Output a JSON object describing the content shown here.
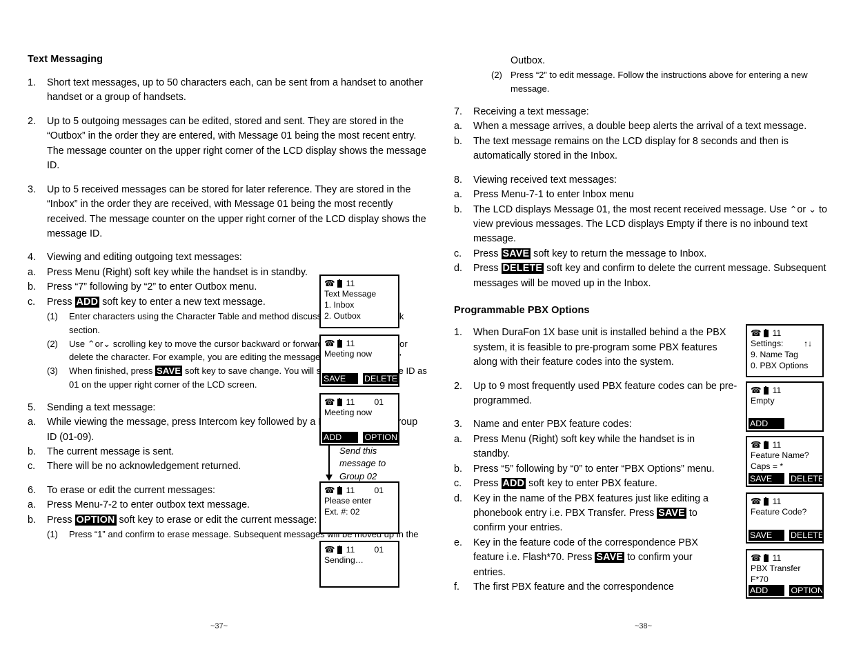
{
  "left_column": {
    "heading": "Text Messaging",
    "items": [
      {
        "num": "1.",
        "text": "Short text messages, up to 50 characters each, can be sent from a handset to another handset or a group of handsets."
      },
      {
        "num": "2.",
        "text": "Up to 5 outgoing messages can be edited, stored and sent.  They are stored in the “Outbox” in the order they are entered, with Message 01 being the most recent entry.  The message counter on the upper right corner of the LCD display shows the message ID."
      },
      {
        "num": "3.",
        "text": "Up to 5 received messages can be stored for later reference.  They are stored in the “Inbox” in the order they are received, with Message 01 being the most recently received.  The message counter on the upper right corner of the LCD display shows the message ID."
      },
      {
        "num": "4.",
        "text": "Viewing and editing outgoing text messages:"
      },
      {
        "num": "5.",
        "text": "Sending a text message:"
      },
      {
        "num": "6.",
        "text": "To erase or edit the current messages:"
      }
    ],
    "item4_sub": [
      {
        "num": "a.",
        "text": "Press Menu (Right) soft key while the handset is in standby."
      },
      {
        "num": "b.",
        "text": "Press “7”  following by “2” to enter Outbox menu."
      }
    ],
    "item4c": {
      "num": "c.",
      "pre": "Press ",
      "key": "ADD",
      "post": " soft key to enter a new text message."
    },
    "item4c_sub": [
      {
        "num": "(1)",
        "text": "Enter characters using the Character Table and method discussed in the Phonebook section."
      },
      {
        "num": "(2)",
        "pre": "Use ",
        "arrow_up": "⌃",
        "mid": "or",
        "arrow_down": "⌄",
        "post": " scrolling key to move the cursor backward or forward to insert character or delete the character. For example, you are editing the message 1 as “Meeting now.”"
      },
      {
        "num": "(3)",
        "pre": "When finished, press ",
        "key": "SAVE",
        "post": " soft key to save change. You will see the Text Message ID as 01 on the upper right corner of the LCD screen."
      }
    ],
    "item5_sub": [
      {
        "num": "a.",
        "text": "While viewing the message, press Intercom key followed by a Handset ID or a Group ID (01-09)."
      },
      {
        "num": "b.",
        "text": "The current message is sent."
      },
      {
        "num": "c.",
        "text": "There will be no acknowledgement returned."
      }
    ],
    "item6_sub": [
      {
        "num": "a.",
        "text": "Press Menu-7-2 to enter outbox text message."
      }
    ],
    "item6b": {
      "num": "b.",
      "pre": "Press ",
      "key": "OPTION",
      "post": " soft key to erase or edit the current message:"
    },
    "item6b_sub": [
      {
        "num": "(1)",
        "text": "Press “1” and confirm to erase message.  Subsequent messages will be moved up in the"
      }
    ]
  },
  "right_column": {
    "continued": [
      {
        "num": "",
        "text": "Outbox."
      },
      {
        "num": "(2)",
        "text": "Press “2” to edit message.  Follow the instructions above for entering a new message."
      }
    ],
    "items": [
      {
        "num": "7.",
        "text": "Receiving a text message:"
      },
      {
        "num": "8.",
        "text": "Viewing received text messages:"
      }
    ],
    "item7_sub": [
      {
        "num": "a.",
        "text": "When a message arrives, a double beep alerts the arrival of a text message."
      },
      {
        "num": "b.",
        "text": "The text message remains on the LCD display for 8 seconds and then is automatically stored in the Inbox."
      }
    ],
    "item8_sub": [
      {
        "num": "a.",
        "text": "Press Menu-7-1 to enter Inbox menu"
      }
    ],
    "item8b": {
      "num": "b.",
      "pre": "The LCD displays Message 01, the most recent received message. Use ",
      "arrow_up": "⌃",
      "mid": "or ",
      "arrow_down": "⌄",
      "post": " to view previous messages. The LCD displays Empty if there is no inbound text message."
    },
    "item8c": {
      "num": "c.",
      "pre": "Press ",
      "key": "SAVE",
      "post": " soft key to return the message to Inbox."
    },
    "item8d": {
      "num": "d.",
      "pre": "Press ",
      "key": "DELETE",
      "post": " soft key and confirm to delete the current message. Subsequent messages will be moved up in the Inbox."
    },
    "heading2": "Programmable PBX Options",
    "pbx_items": [
      {
        "num": "1.",
        "text": "When DuraFon 1X base unit is installed behind a the PBX system, it is feasible to pre-program some PBX features along with their feature codes into the system."
      },
      {
        "num": "2.",
        "text": "Up to 9 most frequently used PBX feature codes can be pre-programmed."
      },
      {
        "num": "3.",
        "text": "Name and enter PBX feature codes:"
      }
    ],
    "pbx3_sub": [
      {
        "num": "a.",
        "text": "Press Menu (Right) soft key while the handset is in standby."
      },
      {
        "num": "b.",
        "text": "Press “5”  following by “0” to enter “PBX Options” menu."
      }
    ],
    "pbx3c": {
      "num": "c.",
      "pre": "Press ",
      "key": "ADD",
      "post": " soft key to enter PBX feature."
    },
    "pbx3d": {
      "num": "d.",
      "pre": "Key in the name of the PBX features just like editing a phonebook entry i.e. PBX Transfer. Press ",
      "key": "SAVE",
      "post": " to confirm your entries."
    },
    "pbx3e": {
      "num": "e.",
      "pre": "Key in the feature code of the correspondence PBX feature i.e. Flash*70. Press ",
      "key": "SAVE",
      "post": " to confirm your entries."
    },
    "pbx3f": {
      "num": "f.",
      "text": "The first PBX feature and the correspondence"
    }
  },
  "lcd_screens": {
    "left": [
      {
        "name": "text-message-menu",
        "handset_id": "11",
        "msg_id": "",
        "lines": [
          "Text Message",
          "1. Inbox",
          "2. Outbox"
        ],
        "softkeys": []
      },
      {
        "name": "editing-message",
        "handset_id": "11",
        "msg_id": "",
        "lines": [
          "Meeting now"
        ],
        "softkeys": [
          "SAVE",
          "DELETE"
        ]
      },
      {
        "name": "saved-message",
        "handset_id": "11",
        "msg_id": "01",
        "lines": [
          "Meeting now"
        ],
        "softkeys": [
          "ADD",
          "OPTION"
        ]
      },
      {
        "name": "enter-extension",
        "handset_id": "11",
        "msg_id": "01",
        "lines": [
          "Please enter",
          "Ext. #: 02"
        ],
        "softkeys": []
      },
      {
        "name": "sending",
        "handset_id": "11",
        "msg_id": "01",
        "lines": [
          "Sending…"
        ],
        "softkeys": []
      }
    ],
    "left_annotation": "Send this message to Group 02",
    "right": [
      {
        "name": "settings-menu",
        "handset_id": "11",
        "msg_id": "",
        "lines": [
          "Settings:",
          "9. Name Tag",
          "0. PBX Options"
        ],
        "arrows": "↑↓",
        "softkeys": []
      },
      {
        "name": "pbx-empty",
        "handset_id": "11",
        "msg_id": "",
        "lines": [
          "Empty"
        ],
        "softkeys": [
          "ADD"
        ]
      },
      {
        "name": "feature-name-prompt",
        "handset_id": "11",
        "msg_id": "",
        "lines": [
          "Feature Name?",
          "Caps = *"
        ],
        "softkeys": [
          "SAVE",
          "DELETE"
        ]
      },
      {
        "name": "feature-code-prompt",
        "handset_id": "11",
        "msg_id": "",
        "lines": [
          "Feature Code?"
        ],
        "softkeys": [
          "SAVE",
          "DELETE"
        ]
      },
      {
        "name": "pbx-transfer-entry",
        "handset_id": "11",
        "msg_id": "",
        "lines": [
          "PBX Transfer",
          "F*70"
        ],
        "softkeys": [
          "ADD",
          "OPTION"
        ]
      }
    ]
  },
  "footer": {
    "page_left": "~37~",
    "page_right": "~38~"
  },
  "icons": {
    "phone": "☎",
    "battery": "battery-icon"
  }
}
